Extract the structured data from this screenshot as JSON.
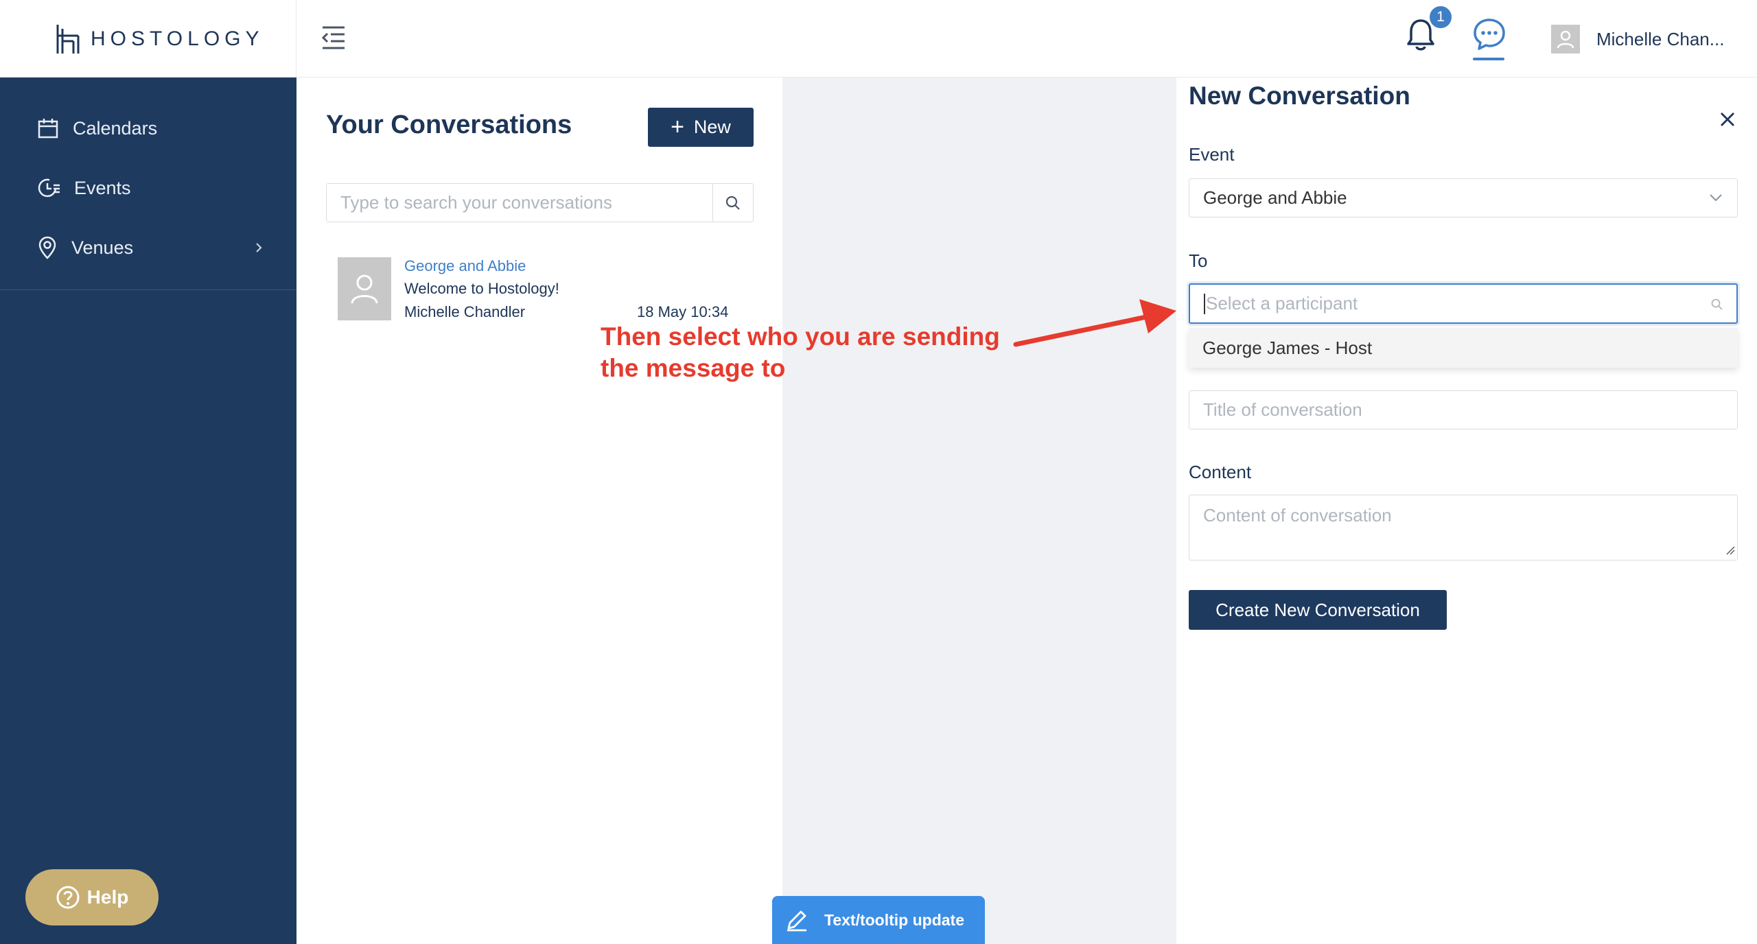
{
  "app": {
    "logo_text": "HOSTOLOGY"
  },
  "header": {
    "notification_count": "1",
    "user_name": "Michelle Chan..."
  },
  "sidebar": {
    "items": [
      {
        "label": "Calendars",
        "icon": "calendar-icon"
      },
      {
        "label": "Events",
        "icon": "events-icon"
      },
      {
        "label": "Venues",
        "icon": "location-pin-icon"
      }
    ],
    "help_label": "Help"
  },
  "conversations": {
    "title": "Your Conversations",
    "new_label": "New",
    "search_placeholder": "Type to search your conversations",
    "items": [
      {
        "event": "George and Abbie",
        "subject": "Welcome to Hostology!",
        "sender": "Michelle Chandler",
        "date": "18 May 10:34"
      }
    ]
  },
  "annotation": {
    "line1": "Then select who you are sending",
    "line2": "the message to",
    "color": "#e63b2e"
  },
  "tooltip_button": {
    "label": "Text/tooltip update"
  },
  "new_conversation": {
    "title": "New Conversation",
    "event_label": "Event",
    "event_value": "George and Abbie",
    "to_label": "To",
    "to_placeholder": "Select a participant",
    "participant_option": "George James - Host",
    "title_placeholder": "Title of conversation",
    "content_label": "Content",
    "content_placeholder": "Content of conversation",
    "create_label": "Create New Conversation"
  },
  "colors": {
    "sidebar": "#1f3a5f",
    "accent": "#3f7fc6",
    "help": "#c8b074",
    "tooltip": "#3b8ee6"
  }
}
